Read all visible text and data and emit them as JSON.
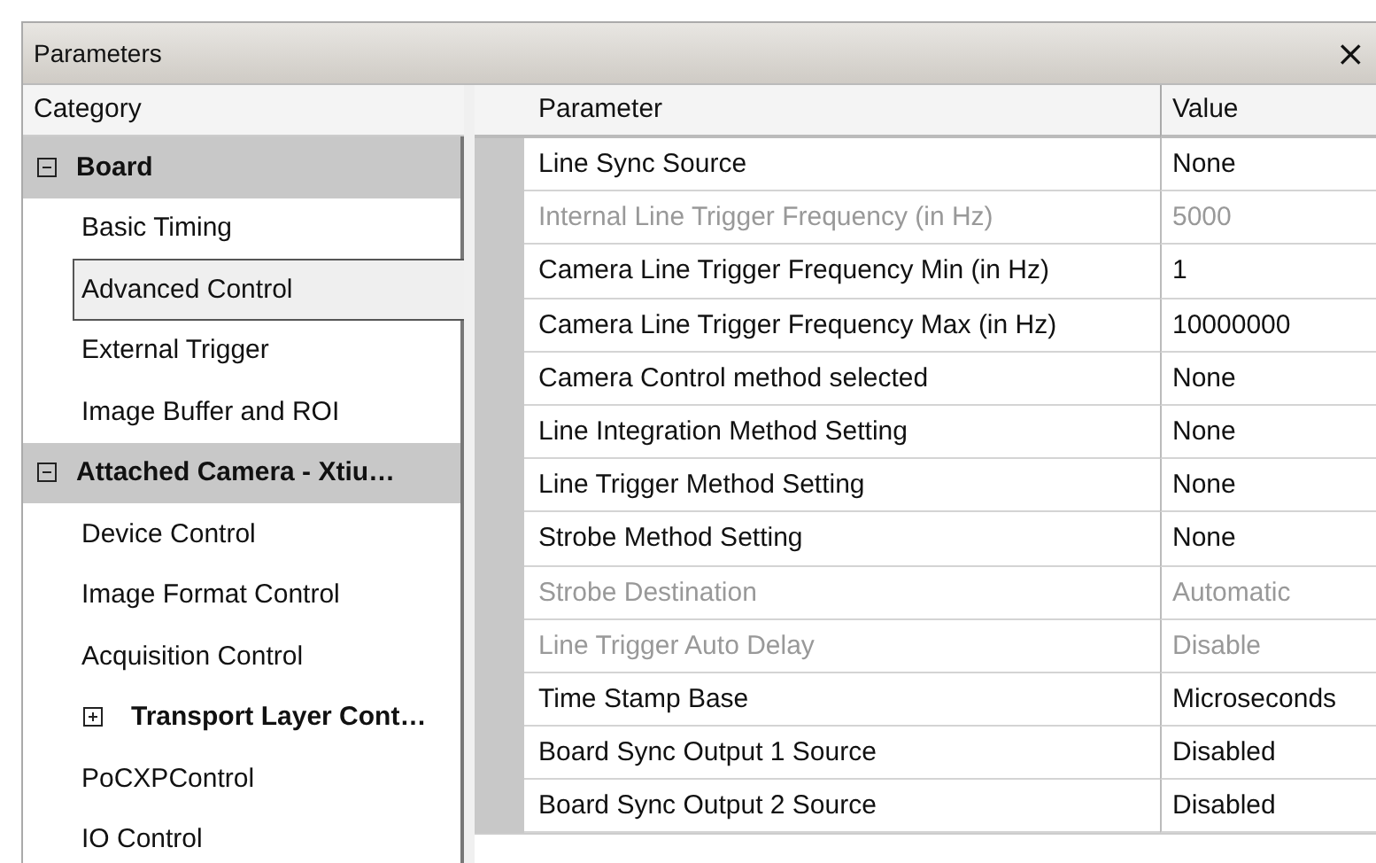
{
  "window": {
    "title": "Parameters",
    "close": "×"
  },
  "category_header": "Category",
  "categories": [
    {
      "kind": "group",
      "label": "Board",
      "expanded": true,
      "children": [
        {
          "kind": "item",
          "label": "Basic Timing",
          "selected": false
        },
        {
          "kind": "item",
          "label": "Advanced Control",
          "selected": true
        },
        {
          "kind": "item",
          "label": "External Trigger",
          "selected": false
        },
        {
          "kind": "item",
          "label": "Image Buffer and ROI",
          "selected": false
        }
      ]
    },
    {
      "kind": "group",
      "label": "Attached Camera - Xtiu…",
      "expanded": true,
      "children": [
        {
          "kind": "item",
          "label": "Device Control",
          "selected": false
        },
        {
          "kind": "item",
          "label": "Image Format Control",
          "selected": false
        },
        {
          "kind": "item",
          "label": "Acquisition Control",
          "selected": false
        },
        {
          "kind": "group",
          "label": "Transport Layer Cont…",
          "expanded": false
        },
        {
          "kind": "item",
          "label": "PoCXPControl",
          "selected": false
        },
        {
          "kind": "item",
          "label": "IO Control",
          "selected": false
        }
      ]
    }
  ],
  "table": {
    "columns": [
      "Parameter",
      "Value"
    ],
    "rows": [
      {
        "parameter": "Line Sync Source",
        "value": "None",
        "disabled": false
      },
      {
        "parameter": "Internal Line Trigger Frequency (in Hz)",
        "value": "5000",
        "disabled": true
      },
      {
        "parameter": "Camera Line Trigger Frequency Min (in Hz)",
        "value": "1",
        "disabled": false
      },
      {
        "parameter": "Camera Line Trigger Frequency Max (in Hz)",
        "value": "10000000",
        "disabled": false
      },
      {
        "parameter": "Camera Control method selected",
        "value": "None",
        "disabled": false
      },
      {
        "parameter": "Line Integration Method Setting",
        "value": "None",
        "disabled": false
      },
      {
        "parameter": "Line Trigger Method Setting",
        "value": "None",
        "disabled": false
      },
      {
        "parameter": "Strobe Method Setting",
        "value": "None",
        "disabled": false
      },
      {
        "parameter": "Strobe Destination",
        "value": "Automatic",
        "disabled": true
      },
      {
        "parameter": "Line Trigger Auto Delay",
        "value": "Disable",
        "disabled": true
      },
      {
        "parameter": "Time Stamp Base",
        "value": "Microseconds",
        "disabled": false
      },
      {
        "parameter": "Board Sync Output 1 Source",
        "value": "Disabled",
        "disabled": false
      },
      {
        "parameter": "Board Sync Output 2 Source",
        "value": "Disabled",
        "disabled": false
      }
    ]
  }
}
